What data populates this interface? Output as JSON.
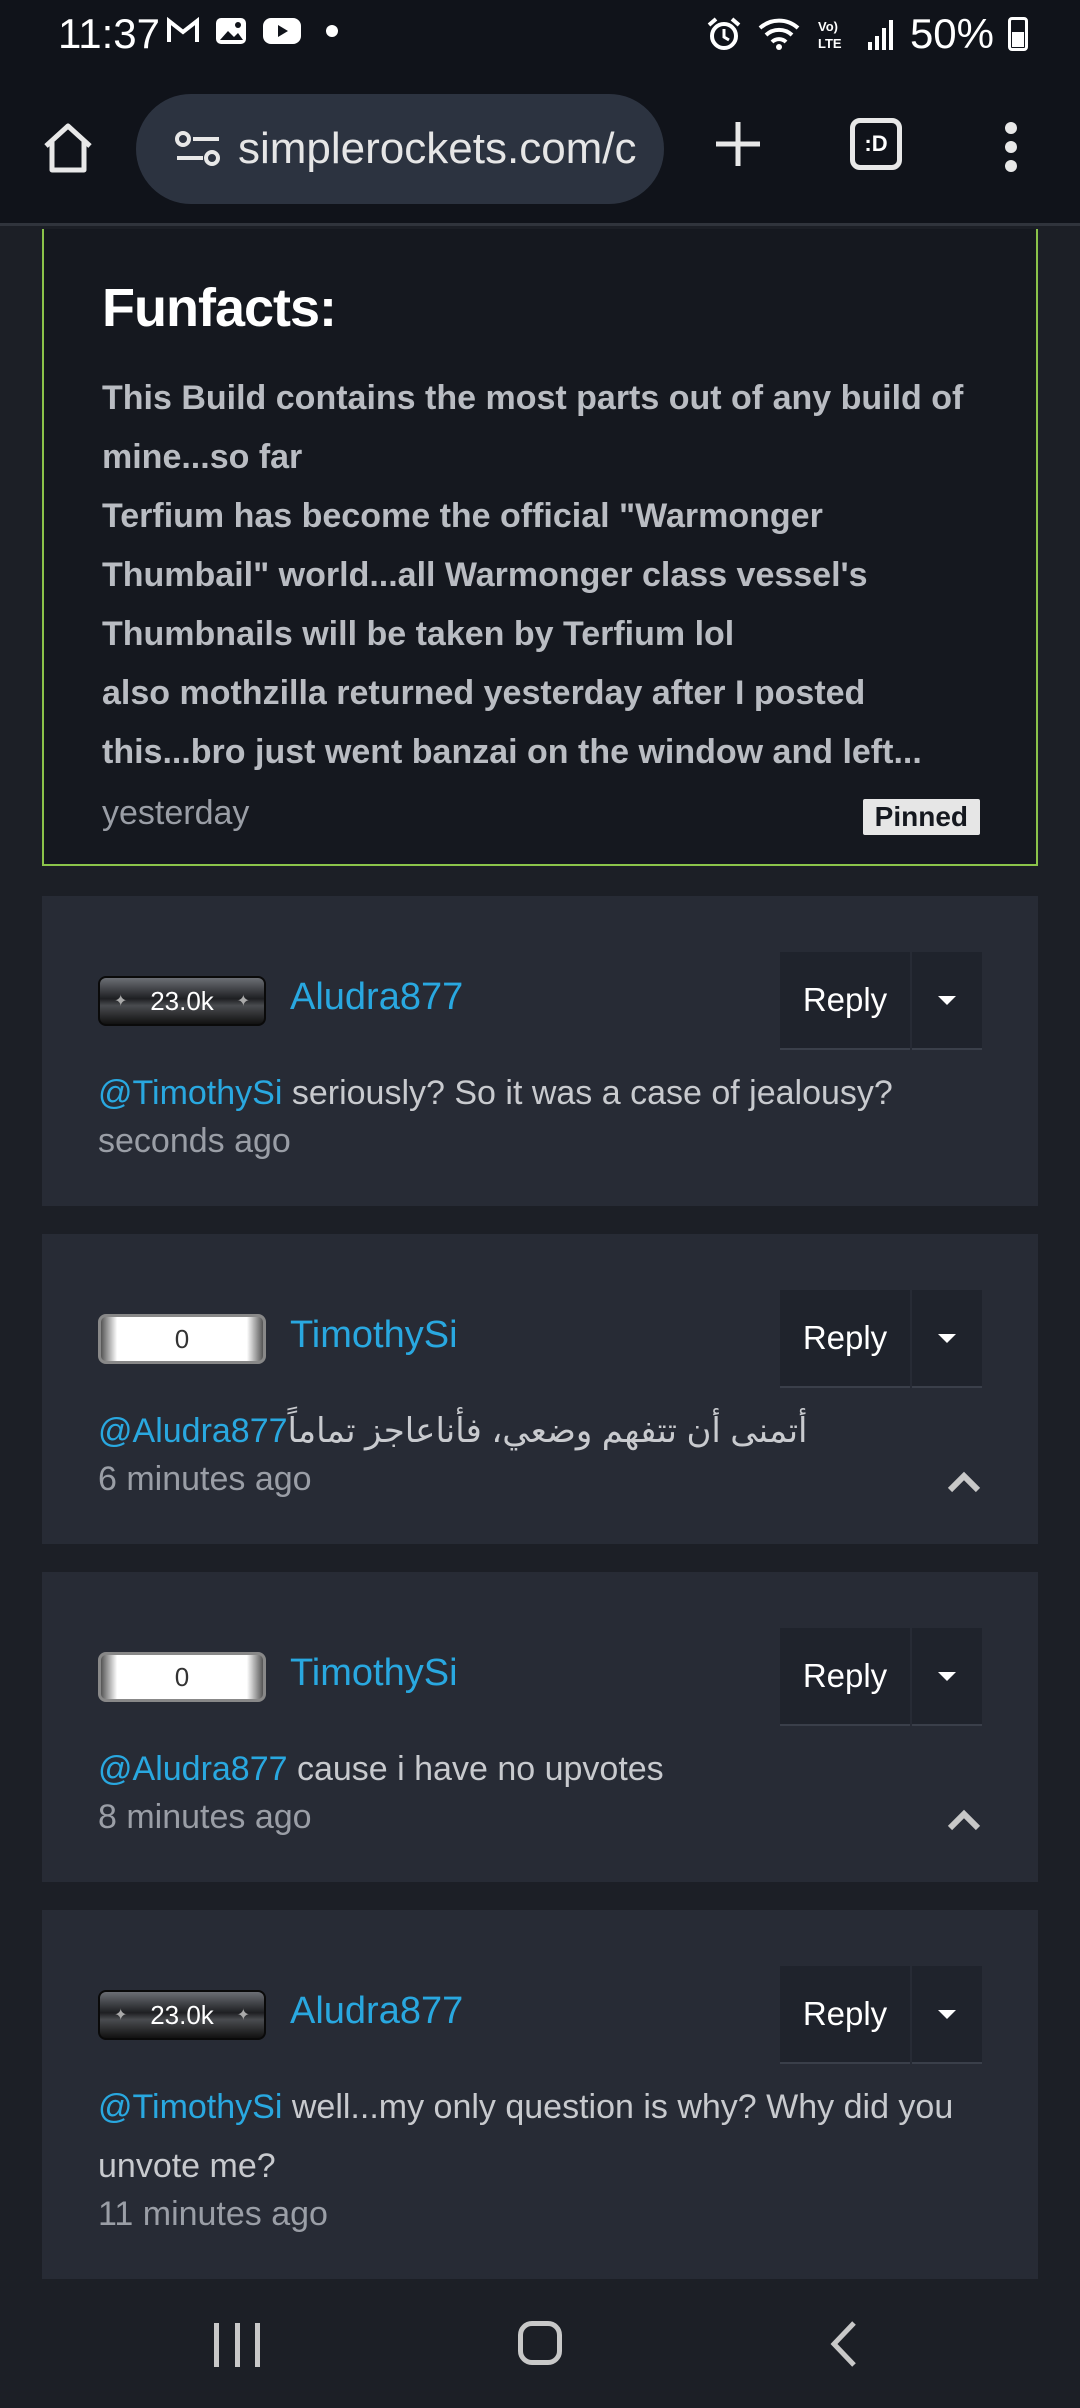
{
  "status_bar": {
    "time": "11:37",
    "battery": "50%",
    "icons": [
      "gmail-icon",
      "gallery-icon",
      "youtube-icon",
      "dot-icon",
      "alarm-icon",
      "wifi-icon",
      "volte-icon",
      "signal-icon",
      "battery-icon"
    ]
  },
  "browser": {
    "url": "simplerockets.com/c",
    "tabs_label": ":D"
  },
  "pinned_comment": {
    "heading": "Funfacts:",
    "lines": [
      "This Build contains the most parts out of any build of",
      "mine...so far",
      "Terfium has become the official \"Warmonger",
      "Thumbail\" world...all Warmonger class vessel's",
      "Thumbnails will be taken by Terfium lol",
      "also mothzilla returned yesterday after I posted",
      "this...bro just went banzai on the window and left..."
    ],
    "time": "yesterday",
    "badge": "Pinned",
    "border_color": "#8bc34a"
  },
  "comments": [
    {
      "rep": "23.0k",
      "user": "Aludra877",
      "reply": "Reply",
      "mention": "@TimothySi",
      "text": " seriously? So it was a case of jealousy?",
      "text2": "",
      "time": "seconds ago"
    },
    {
      "rep": "0",
      "user": "TimothySi",
      "reply": "Reply",
      "mention": "@Aludra877",
      "text": " أتمنى أن تتفهم وضعي، فأناعاجز تماماً",
      "text2": "",
      "time": "6 minutes ago"
    },
    {
      "rep": "0",
      "user": "TimothySi",
      "reply": "Reply",
      "mention": "@Aludra877",
      "text": " cause i have no upvotes",
      "text2": "",
      "time": "8 minutes ago"
    },
    {
      "rep": "23.0k",
      "user": "Aludra877",
      "reply": "Reply",
      "mention": "@TimothySi",
      "text": " well...my only question is why? Why did you",
      "text2": "unvote me?",
      "time": "11 minutes ago"
    }
  ],
  "colors": {
    "link": "#29a8e0",
    "card": "#272b35",
    "page": "#1c1f26"
  }
}
